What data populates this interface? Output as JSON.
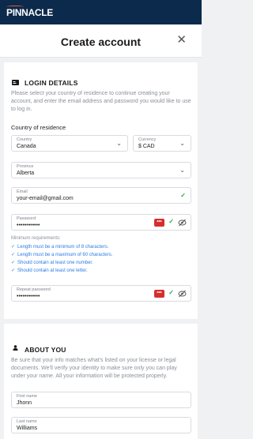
{
  "brand": {
    "logo_text": "PINNACLE"
  },
  "header": {
    "title": "Create account",
    "close_icon": "close-icon"
  },
  "login_details": {
    "title": "LOGIN DETAILS",
    "icon": "id-card-icon",
    "description": "Please select your country of residence to continue creating your account, and enter the email address and password you would like to use to log in.",
    "country_heading": "Country of residence",
    "country": {
      "label": "Country",
      "value": "Canada"
    },
    "currency": {
      "label": "Currency",
      "value": "$  CAD"
    },
    "province": {
      "label": "Province",
      "value": "Alberta"
    },
    "email": {
      "label": "Email",
      "value": "your-email@gmail.com"
    },
    "password": {
      "label": "Password",
      "value": "••••••••••••",
      "generator": "•••"
    },
    "requirements_title": "Minimum requirements:",
    "requirements": [
      "Length must be a minimum of 8 characters.",
      "Length must be a maximum of 60 characters.",
      "Should contain at least one number.",
      "Should contain at least one letter."
    ],
    "repeat_password": {
      "label": "Repeat password",
      "value": "••••••••••••",
      "generator": "•••"
    }
  },
  "about_you": {
    "title": "ABOUT YOU",
    "icon": "person-icon",
    "description": "Be sure that your info matches what's listed on your license or legal documents. We'll verify your identity to make sure only you can play under your name. All your information will be protected properly.",
    "first_name": {
      "label": "First name",
      "value": "Jhonn"
    },
    "last_name": {
      "label": "Last name",
      "value": "Williams"
    }
  },
  "colors": {
    "topbar": "#0c2a4c",
    "accent": "#e8612c",
    "valid": "#2aa747",
    "requirement": "#2c7be5",
    "danger": "#d62d2d"
  }
}
